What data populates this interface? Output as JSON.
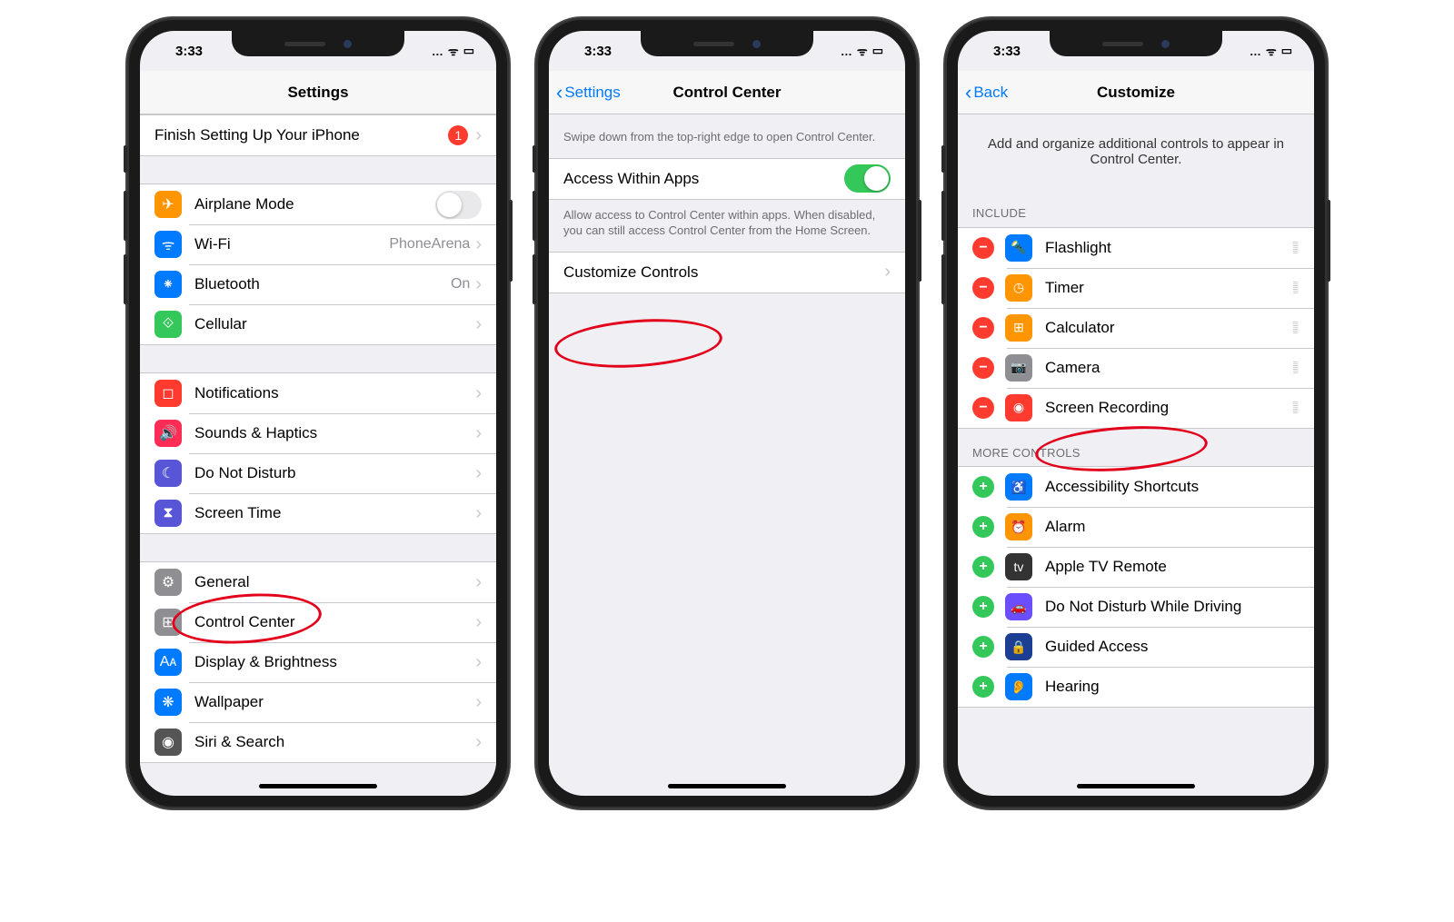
{
  "status": {
    "time": "3:33",
    "sig": "…",
    "wifi": "ᯤ",
    "batt": "▭"
  },
  "s1": {
    "title": "Settings",
    "setup": {
      "label": "Finish Setting Up Your iPhone",
      "badge": "1"
    },
    "net": [
      {
        "label": "Airplane Mode",
        "icon": "✈",
        "bg": "ic-orange",
        "toggle": "off"
      },
      {
        "label": "Wi-Fi",
        "icon": "ᯤ",
        "bg": "ic-blue",
        "detail": "PhoneArena"
      },
      {
        "label": "Bluetooth",
        "icon": "⁕",
        "bg": "ic-blue",
        "detail": "On"
      },
      {
        "label": "Cellular",
        "icon": "⟐",
        "bg": "ic-green"
      }
    ],
    "notif": [
      {
        "label": "Notifications",
        "icon": "◻",
        "bg": "ic-red"
      },
      {
        "label": "Sounds & Haptics",
        "icon": "🔊",
        "bg": "ic-pink"
      },
      {
        "label": "Do Not Disturb",
        "icon": "☾",
        "bg": "ic-purple"
      },
      {
        "label": "Screen Time",
        "icon": "⧗",
        "bg": "ic-purple"
      }
    ],
    "gen": [
      {
        "label": "General",
        "icon": "⚙",
        "bg": "ic-gray"
      },
      {
        "label": "Control Center",
        "icon": "⊞",
        "bg": "ic-gray"
      },
      {
        "label": "Display & Brightness",
        "icon": "Aᴀ",
        "bg": "ic-blue"
      },
      {
        "label": "Wallpaper",
        "icon": "❋",
        "bg": "ic-blue"
      },
      {
        "label": "Siri & Search",
        "icon": "◉",
        "bg": "ic-dgray"
      }
    ]
  },
  "s2": {
    "back": "Settings",
    "title": "Control Center",
    "desc": "Swipe down from the top-right edge to open Control Center.",
    "access": {
      "label": "Access Within Apps",
      "toggle": "on"
    },
    "access_footer": "Allow access to Control Center within apps. When disabled, you can still access Control Center from the Home Screen.",
    "customize": "Customize Controls"
  },
  "s3": {
    "back": "Back",
    "title": "Customize",
    "intro": "Add and organize additional controls to appear in Control Center.",
    "h_include": "Include",
    "h_more": "More Controls",
    "include": [
      {
        "label": "Flashlight",
        "icon": "🔦",
        "bg": "ic-blue"
      },
      {
        "label": "Timer",
        "icon": "◷",
        "bg": "ic-orange"
      },
      {
        "label": "Calculator",
        "icon": "⊞",
        "bg": "ic-orange"
      },
      {
        "label": "Camera",
        "icon": "📷",
        "bg": "ic-gray"
      },
      {
        "label": "Screen Recording",
        "icon": "◉",
        "bg": "ic-red"
      }
    ],
    "more": [
      {
        "label": "Accessibility Shortcuts",
        "icon": "♿",
        "bg": "ic-blue"
      },
      {
        "label": "Alarm",
        "icon": "⏰",
        "bg": "ic-orange"
      },
      {
        "label": "Apple TV Remote",
        "icon": "tv",
        "bg": "ic-tv"
      },
      {
        "label": "Do Not Disturb While Driving",
        "icon": "🚗",
        "bg": "ic-bpurple"
      },
      {
        "label": "Guided Access",
        "icon": "🔒",
        "bg": "ic-navy"
      },
      {
        "label": "Hearing",
        "icon": "👂",
        "bg": "ic-blue"
      }
    ]
  }
}
